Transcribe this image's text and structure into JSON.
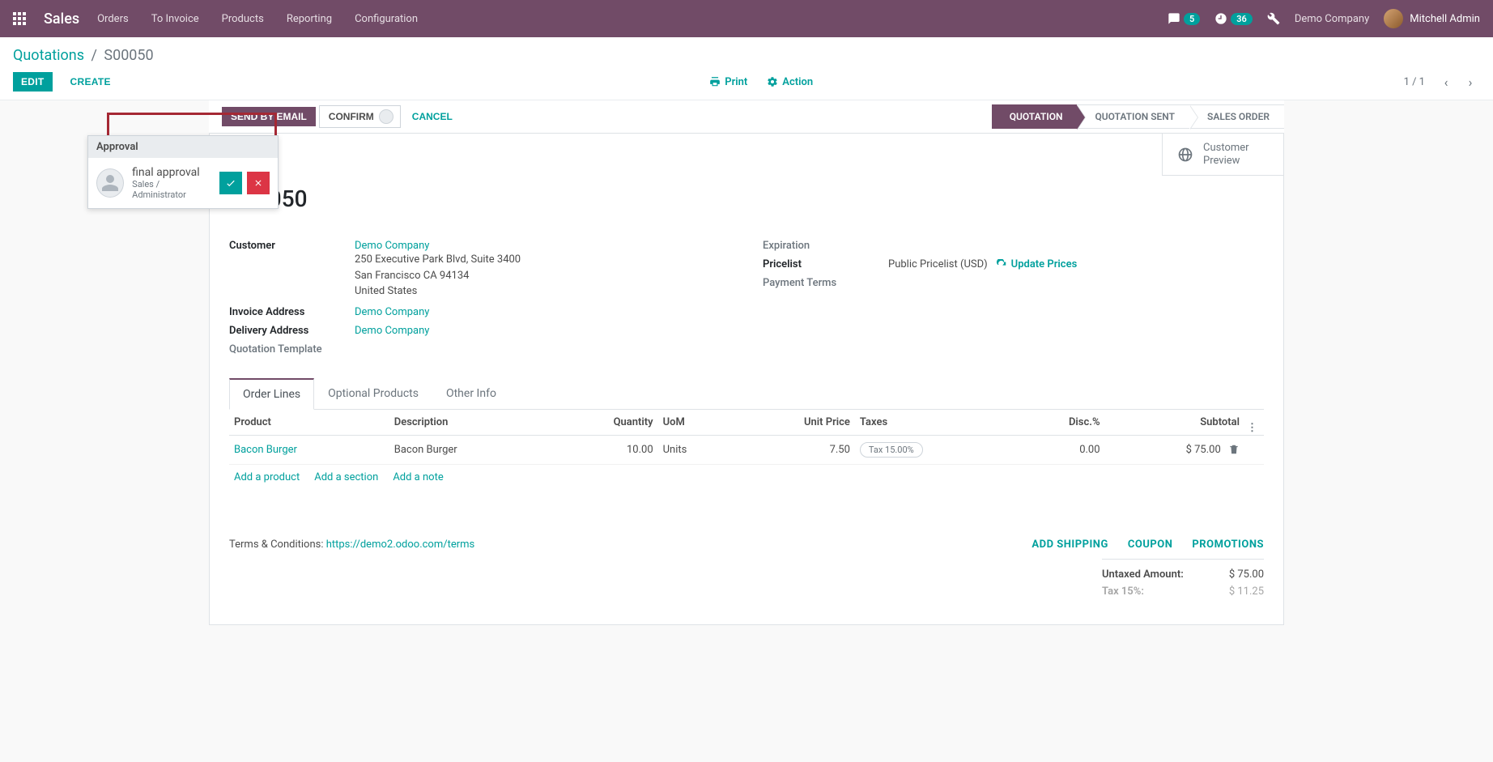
{
  "nav": {
    "brand": "Sales",
    "menu": [
      "Orders",
      "To Invoice",
      "Products",
      "Reporting",
      "Configuration"
    ],
    "chat_count": "5",
    "activity_count": "36",
    "company": "Demo Company",
    "user": "Mitchell Admin"
  },
  "breadcrumb": {
    "root": "Quotations",
    "leaf": "S00050"
  },
  "controls": {
    "edit": "Edit",
    "create": "Create",
    "print": "Print",
    "action": "Action",
    "pager": "1 / 1"
  },
  "statusbar": {
    "send": "Send by Email",
    "confirm": "Confirm",
    "cancel": "Cancel",
    "stages": [
      "Quotation",
      "Quotation Sent",
      "Sales Order"
    ],
    "active_stage": 0
  },
  "approval": {
    "header": "Approval",
    "title": "final approval",
    "subtitle": "Sales / Administrator"
  },
  "stat_button": {
    "line1": "Customer",
    "line2": "Preview"
  },
  "record": {
    "name": "S00050",
    "labels": {
      "customer": "Customer",
      "invoice_addr": "Invoice Address",
      "delivery_addr": "Delivery Address",
      "quote_tmpl": "Quotation Template",
      "expiration": "Expiration",
      "pricelist": "Pricelist",
      "payment_terms": "Payment Terms"
    },
    "customer_link": "Demo Company",
    "customer_addr1": "250 Executive Park Blvd, Suite 3400",
    "customer_addr2": "San Francisco CA 94134",
    "customer_addr3": "United States",
    "invoice_addr_link": "Demo Company",
    "delivery_addr_link": "Demo Company",
    "pricelist_value": "Public Pricelist (USD)",
    "update_prices": "Update Prices"
  },
  "tabs": [
    "Order Lines",
    "Optional Products",
    "Other Info"
  ],
  "order_lines": {
    "headers": {
      "product": "Product",
      "description": "Description",
      "quantity": "Quantity",
      "uom": "UoM",
      "unit_price": "Unit Price",
      "taxes": "Taxes",
      "disc": "Disc.%",
      "subtotal": "Subtotal"
    },
    "rows": [
      {
        "product": "Bacon Burger",
        "description": "Bacon Burger",
        "quantity": "10.00",
        "uom": "Units",
        "unit_price": "7.50",
        "tax": "Tax 15.00%",
        "disc": "0.00",
        "subtotal": "$ 75.00"
      }
    ],
    "add_product": "Add a product",
    "add_section": "Add a section",
    "add_note": "Add a note"
  },
  "footer": {
    "terms_label": "Terms & Conditions: ",
    "terms_link": "https://demo2.odoo.com/terms",
    "promo": {
      "shipping": "Add Shipping",
      "coupon": "Coupon",
      "promotions": "Promotions"
    },
    "totals": {
      "untaxed_label": "Untaxed Amount:",
      "untaxed_value": "$ 75.00",
      "tax_label": "Tax 15%:",
      "tax_value": "$ 11.25"
    }
  }
}
